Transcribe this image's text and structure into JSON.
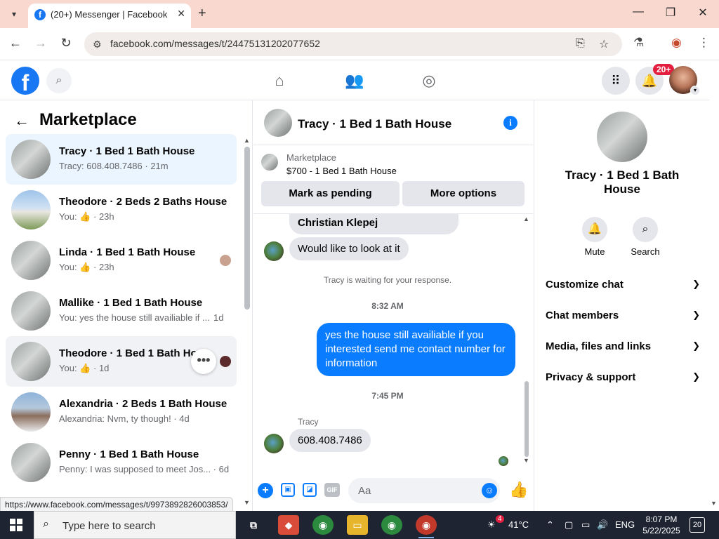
{
  "browser": {
    "tab_title": "(20+) Messenger | Facebook",
    "url": "facebook.com/messages/t/24475131202077652",
    "status_url": "https://www.facebook.com/messages/t/9973892826003853/"
  },
  "fb_header": {
    "notification_badge": "20+"
  },
  "left": {
    "title": "Marketplace",
    "conversations": [
      {
        "name": "Tracy · 1 Bed 1 Bath House",
        "preview": "Tracy: 608.408.7486 · 21m"
      },
      {
        "name": "Theodore · 2 Beds 2 Baths House",
        "prefix": "You:",
        "time": "· 23h"
      },
      {
        "name": "Linda · 1 Bed 1 Bath House",
        "prefix": "You:",
        "time": "· 23h"
      },
      {
        "name": "Mallike · 1 Bed 1 Bath House",
        "preview": "You: yes the house still availiable if ...",
        "time": "1d"
      },
      {
        "name": "Theodore · 1 Bed 1 Bath House",
        "prefix": "You:",
        "time": "· 1d"
      },
      {
        "name": "Alexandria · 2 Beds 1 Bath House",
        "preview": "Alexandria: Nvm, ty though! · 4d"
      },
      {
        "name": "Penny · 1 Bed 1 Bath House",
        "preview": "Penny: I was supposed to meet Jos... · 6d"
      }
    ]
  },
  "chat": {
    "title": "Tracy · 1 Bed 1 Bath House",
    "listing_source": "Marketplace",
    "listing_price_title": "$700 - 1 Bed 1 Bath House",
    "mark_pending_label": "Mark as pending",
    "more_options_label": "More options",
    "messages": {
      "partial": "Christian Klepej",
      "incoming_1": "Would like to look at it",
      "waiting": "Tracy is waiting for your response.",
      "time_1": "8:32 AM",
      "outgoing_1": "yes the house still availiable if you interested send me contact number for information",
      "time_2": "7:45 PM",
      "sender": "Tracy",
      "incoming_2": "608.408.7486"
    },
    "composer_placeholder": "Aa",
    "gif_label": "GIF"
  },
  "right": {
    "name": "Tracy · 1 Bed 1 Bath House",
    "actions": [
      {
        "label": "Mute"
      },
      {
        "label": "Search"
      }
    ],
    "sections": [
      "Customize chat",
      "Chat members",
      "Media, files and links",
      "Privacy & support"
    ]
  },
  "taskbar": {
    "search_placeholder": "Type here to search",
    "weather_badge": "4",
    "temperature": "41°C",
    "language": "ENG",
    "time": "8:07 PM",
    "date": "5/22/2025",
    "notification_count": "20"
  },
  "colors": {
    "messenger_blue": "#0a7cff",
    "facebook_blue": "#1877f2",
    "tab_bar": "#f9d9cf"
  }
}
